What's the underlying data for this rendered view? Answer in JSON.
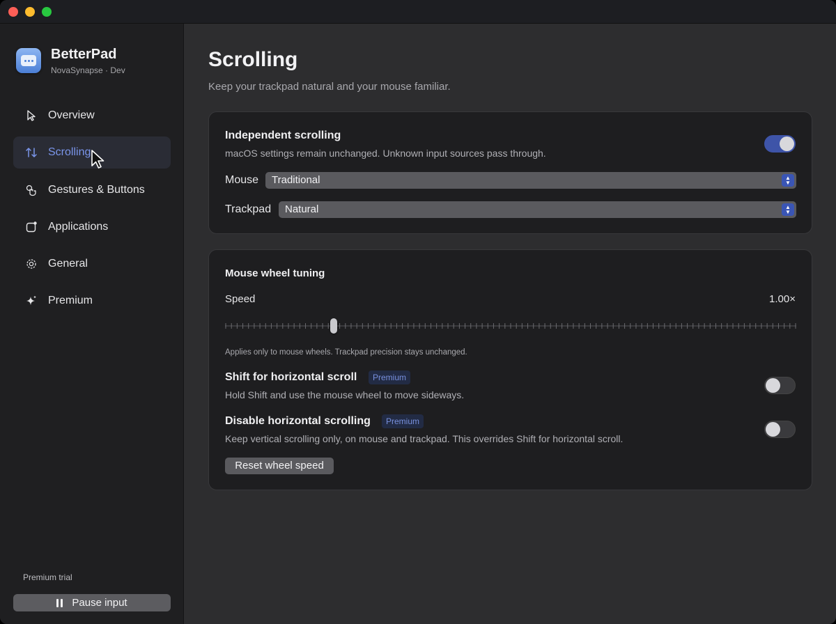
{
  "app": {
    "name": "BetterPad",
    "subtitle": "NovaSynapse · Dev"
  },
  "sidebar": {
    "items": [
      {
        "label": "Overview",
        "icon": "pointer-icon",
        "active": false
      },
      {
        "label": "Scrolling",
        "icon": "arrows-updown-icon",
        "active": true
      },
      {
        "label": "Gestures & Buttons",
        "icon": "hand-tap-icon",
        "active": false
      },
      {
        "label": "Applications",
        "icon": "app-window-icon",
        "active": false
      },
      {
        "label": "General",
        "icon": "gear-icon",
        "active": false
      },
      {
        "label": "Premium",
        "icon": "sparkle-icon",
        "active": false
      }
    ],
    "trial_label": "Premium trial",
    "pause_label": "Pause input"
  },
  "page": {
    "title": "Scrolling",
    "subtitle": "Keep your trackpad natural and your mouse familiar."
  },
  "independent": {
    "title": "Independent scrolling",
    "desc": "macOS settings remain unchanged. Unknown input sources pass through.",
    "enabled": true,
    "mouse_label": "Mouse",
    "mouse_value": "Traditional",
    "trackpad_label": "Trackpad",
    "trackpad_value": "Natural"
  },
  "wheel": {
    "title": "Mouse wheel tuning",
    "speed_label": "Speed",
    "speed_value": "1.00×",
    "speed_fraction": 0.19,
    "note": "Applies only to mouse wheels. Trackpad precision stays unchanged.",
    "shift_title": "Shift for horizontal scroll",
    "shift_badge": "Premium",
    "shift_desc": "Hold Shift and use the mouse wheel to move sideways.",
    "shift_enabled": false,
    "disable_title": "Disable horizontal scrolling",
    "disable_badge": "Premium",
    "disable_desc": "Keep vertical scrolling only, on mouse and trackpad. This overrides Shift for horizontal scroll.",
    "disable_enabled": false,
    "reset_label": "Reset wheel speed"
  },
  "colors": {
    "accent": "#3e54a8",
    "active_nav_text": "#7a95ea",
    "badge_text": "#7890dd"
  }
}
